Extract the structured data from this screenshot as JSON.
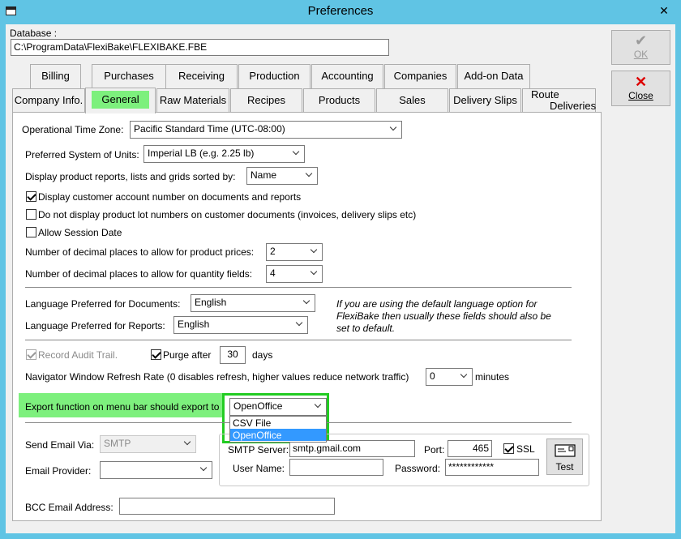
{
  "window": {
    "title": "Preferences"
  },
  "database": {
    "label": "Database :",
    "path": "C:\\ProgramData\\FlexiBake\\FLEXIBAKE.FBE"
  },
  "buttons": {
    "ok": "OK",
    "close": "Close"
  },
  "tabs_row1": [
    "Billing",
    "Purchases",
    "Receiving",
    "Production",
    "Accounting",
    "Companies",
    "Add-on Data"
  ],
  "tabs_row2": [
    "Company Info.",
    "General",
    "Raw Materials",
    "Recipes",
    "Products",
    "Sales",
    "Delivery Slips",
    "Route",
    "Deliveries"
  ],
  "general": {
    "timezone_label": "Operational Time Zone:",
    "timezone_value": "Pacific Standard Time (UTC-08:00)",
    "units_label": "Preferred System of Units:",
    "units_value": "Imperial LB (e.g. 2.25 lb)",
    "sort_label": "Display product reports, lists and grids sorted by:",
    "sort_value": "Name",
    "chk_account": "Display customer account number on documents and reports",
    "chk_lot": "Do not display product lot numbers on customer documents (invoices, delivery slips etc)",
    "chk_session": "Allow Session Date",
    "dec_price_label": "Number of decimal places to allow for product prices:",
    "dec_price_value": "2",
    "dec_qty_label": "Number of decimal places to allow for quantity fields:",
    "dec_qty_value": "4",
    "lang_docs_label": "Language Preferred for Documents:",
    "lang_docs_value": "English",
    "lang_reports_label": "Language Preferred for Reports:",
    "lang_reports_value": "English",
    "lang_note_1": "If you are using the default language option for",
    "lang_note_2": "FlexiBake then usually these fields should also be",
    "lang_note_3": "set to default.",
    "audit_label": "Record Audit Trail.",
    "purge_label": "Purge after",
    "purge_value": "30",
    "purge_unit": "days",
    "refresh_label": "Navigator Window Refresh Rate (0 disables refresh, higher values reduce network traffic)",
    "refresh_value": "0",
    "refresh_unit": "minutes",
    "export_label": "Export function on menu bar should export to",
    "export_value": "OpenOffice",
    "export_options": [
      "CSV File",
      "OpenOffice"
    ],
    "email_via_label": "Send Email Via:",
    "email_via_value": "SMTP",
    "email_provider_label": "Email Provider:",
    "email_provider_value": "",
    "smtp_server_label": "SMTP Server:",
    "smtp_server_value": "smtp.gmail.com",
    "port_label": "Port:",
    "port_value": "465",
    "ssl_label": "SSL",
    "username_label": "User Name:",
    "username_value": "",
    "password_label": "Password:",
    "password_value": "************",
    "test_label": "Test",
    "bcc_label": "BCC Email Address:",
    "bcc_value": ""
  },
  "colors": {
    "titlebar": "#60c4e4",
    "highlight": "#7df07d",
    "focus_border": "#22cc22",
    "selection": "#3399ff"
  }
}
